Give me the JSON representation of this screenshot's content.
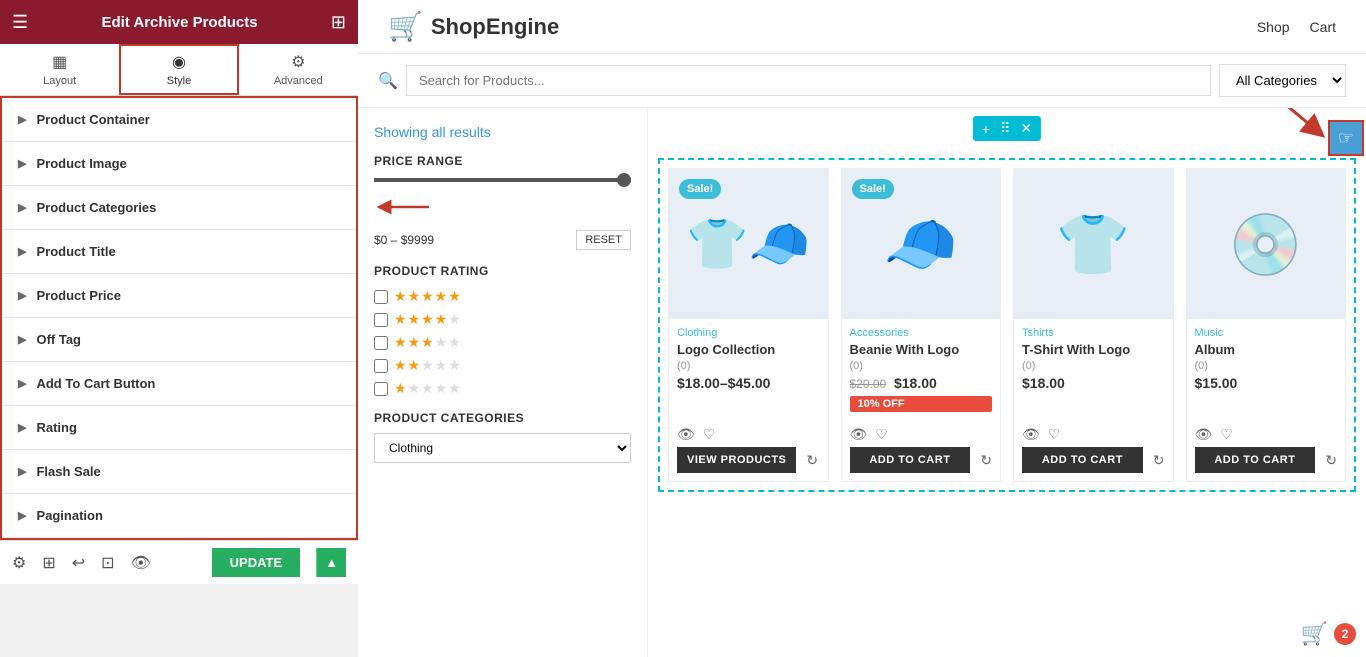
{
  "topBar": {
    "title": "Edit Archive Products",
    "hamburger": "☰",
    "grid": "⊞"
  },
  "tabs": [
    {
      "id": "layout",
      "label": "Layout",
      "icon": "▦",
      "active": false
    },
    {
      "id": "style",
      "label": "Style",
      "icon": "◉",
      "active": true
    },
    {
      "id": "advanced",
      "label": "Advanced",
      "icon": "⚙",
      "active": false
    }
  ],
  "panelItems": [
    {
      "id": "product-container",
      "label": "Product Container"
    },
    {
      "id": "product-image",
      "label": "Product Image"
    },
    {
      "id": "product-categories",
      "label": "Product Categories"
    },
    {
      "id": "product-title",
      "label": "Product Title"
    },
    {
      "id": "product-price",
      "label": "Product Price"
    },
    {
      "id": "off-tag",
      "label": "Off Tag"
    },
    {
      "id": "add-to-cart-button",
      "label": "Add To Cart Button"
    },
    {
      "id": "rating",
      "label": "Rating"
    },
    {
      "id": "flash-sale",
      "label": "Flash Sale"
    },
    {
      "id": "pagination",
      "label": "Pagination"
    }
  ],
  "shopHeader": {
    "logoText": "ShopEngine",
    "navItems": [
      "Shop",
      "Cart"
    ]
  },
  "searchBar": {
    "placeholder": "Search for Products...",
    "category": "All Categories"
  },
  "showingResults": {
    "prefix": "Showing ",
    "highlight": "all",
    "suffix": " results"
  },
  "priceRange": {
    "title": "PRICE RANGE",
    "min": "$0",
    "max": "$9999",
    "resetLabel": "RESET"
  },
  "productRating": {
    "title": "PRODUCT RATING",
    "stars": [
      5,
      4,
      3,
      2,
      1
    ]
  },
  "productCategories": {
    "title": "PRODUCT CATEGORIES",
    "placeholder": "Clothing"
  },
  "products": [
    {
      "category": "Clothing",
      "name": "Logo Collection",
      "rating": "(0)",
      "price": "$18.00–$45.00",
      "originalPrice": null,
      "offBadge": null,
      "hasSale": true,
      "action": "VIEW PRODUCTS",
      "emoji": "👕🧢"
    },
    {
      "category": "Accessories",
      "name": "Beanie With Logo",
      "rating": "(0)",
      "price": "$18.00",
      "originalPrice": "$20.00",
      "offBadge": "10% OFF",
      "hasSale": true,
      "action": "ADD TO CART",
      "emoji": "🧢"
    },
    {
      "category": "Tshirts",
      "name": "T-Shirt With Logo",
      "rating": "(0)",
      "price": "$18.00",
      "originalPrice": null,
      "offBadge": null,
      "hasSale": false,
      "action": "ADD TO CART",
      "emoji": "👕"
    },
    {
      "category": "Music",
      "name": "Album",
      "rating": "(0)",
      "price": "$15.00",
      "originalPrice": null,
      "offBadge": null,
      "hasSale": false,
      "action": "ADD TO CART",
      "emoji": "💿"
    }
  ],
  "widgetToolbar": {
    "addBtn": "+",
    "moveBtn": "⠿",
    "closeBtn": "✕"
  },
  "bottomBar": {
    "updateLabel": "UPDATE",
    "icons": [
      "⚙",
      "⊞",
      "↩",
      "⊡",
      "👁"
    ]
  },
  "notifBadge": "2"
}
